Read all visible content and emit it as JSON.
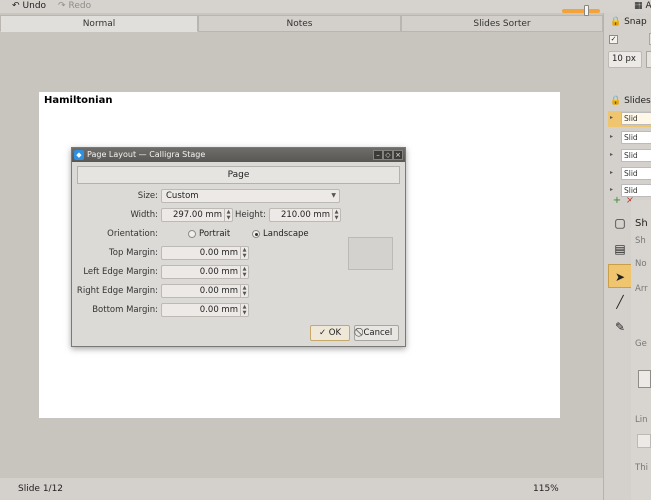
{
  "toolbar": {
    "undo_label": "Undo",
    "redo_label": "Redo",
    "right_label": "A"
  },
  "tabs": [
    {
      "label": "Normal"
    },
    {
      "label": "Notes"
    },
    {
      "label": "Slides Sorter"
    }
  ],
  "slide": {
    "title": "Hamiltonian"
  },
  "dialog": {
    "title": "Page Layout — Calligra Stage",
    "page_tab": "Page",
    "size_label": "Size:",
    "size_value": "Custom",
    "width_label": "Width:",
    "width_value": "297.00 mm",
    "height_label": "Height:",
    "height_value": "210.00 mm",
    "orientation_label": "Orientation:",
    "orientation_options": [
      "Portrait",
      "Landscape"
    ],
    "orientation_selected": "Landscape",
    "top_margin_label": "Top Margin:",
    "top_margin_value": "0.00 mm",
    "left_margin_label": "Left Edge Margin:",
    "left_margin_value": "0.00 mm",
    "right_margin_label": "Right Edge Margin:",
    "right_margin_value": "0.00 mm",
    "bottom_margin_label": "Bottom Margin:",
    "bottom_margin_value": "0.00 mm",
    "ok_label": "OK",
    "cancel_label": "Cancel"
  },
  "statusbar": {
    "slide_count": "Slide 1/12",
    "zoom": "115%",
    "zoom_level": 0.6
  },
  "right_panel": {
    "snap_header": "Snap",
    "snap_value": "10 px",
    "slides_header": "Slides",
    "slide_thumbs": [
      "Slid",
      "Slid",
      "Slid",
      "Slid",
      "Slid"
    ],
    "partial_texts": [
      "Sh",
      "Sh",
      "No",
      "Arr",
      "Ge",
      "Lin",
      "Thi"
    ]
  },
  "colors": {
    "accent": "#f0c56f",
    "zoom_slider": "#f2a33a",
    "titlebar": "#595753"
  }
}
